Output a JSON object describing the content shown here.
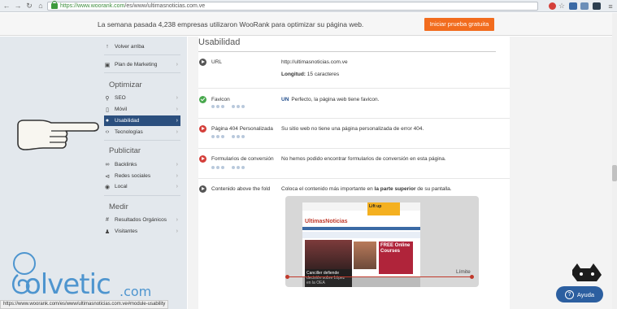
{
  "browser": {
    "back_icon": "back-arrow-icon",
    "forward_icon": "forward-arrow-icon",
    "reload_icon": "reload-icon",
    "home_icon": "home-icon",
    "url_host": "https://www.woorank.com",
    "url_path": "/es/www/ultimasnoticias.com.ve"
  },
  "banner": {
    "text": "La semana pasada 4,238 empresas utilizaron WooRank para optimizar su página web.",
    "cta_label": "Iniciar prueba gratuita",
    "cta_color": "#f26c1e"
  },
  "sidebar": {
    "top_items": [
      {
        "icon": "arrow-up-icon",
        "label": "Volver arriba"
      },
      {
        "icon": "document-icon",
        "label": "Plan de Marketing"
      }
    ],
    "groups": [
      {
        "heading": "Optimizar",
        "items": [
          {
            "icon": "search-icon",
            "label": "SEO"
          },
          {
            "icon": "mobile-icon",
            "label": "Móvil"
          },
          {
            "icon": "user-icon",
            "label": "Usabilidad",
            "active": true
          },
          {
            "icon": "code-icon",
            "label": "Tecnologías"
          }
        ]
      },
      {
        "heading": "Publicitar",
        "items": [
          {
            "icon": "link-icon",
            "label": "Backlinks"
          },
          {
            "icon": "share-icon",
            "label": "Redes sociales"
          },
          {
            "icon": "location-pin-icon",
            "label": "Local"
          }
        ]
      },
      {
        "heading": "Medir",
        "items": [
          {
            "icon": "hashtag-icon",
            "label": "Resultados Orgánicos"
          },
          {
            "icon": "visitors-icon",
            "label": "Visitantes"
          }
        ]
      }
    ],
    "active_color": "#2b4f7e"
  },
  "main": {
    "section_title": "Usabilidad",
    "rows": [
      {
        "label": "URL",
        "status": "neutral",
        "value": "http://ultimasnoticias.com.ve",
        "detail_label": "Longitud:",
        "detail_value": "15 caracteres"
      },
      {
        "label": "Favicon",
        "status": "ok",
        "value_badge": "UN",
        "value": "Perfecto, la página web tiene favicon."
      },
      {
        "label": "Página 404 Personalizada",
        "status": "bad",
        "value": "Su sitio web no tiene una página personalizada de error 404."
      },
      {
        "label": "Formularios de conversión",
        "status": "bad",
        "value": "No hemos podido encontrar formularios de conversión en esta página."
      },
      {
        "label": "Contenido above the fold",
        "status": "neutral",
        "value_pre": "Coloca el contenido más importante en ",
        "value_bold": "la parte superior",
        "value_post": " de su pantalla."
      }
    ],
    "preview": {
      "logo_a": "Ultimas",
      "logo_b": "Noticias",
      "ad_text": "Lift up",
      "caption": "Canciller defiende decisión sobre López en la OEA",
      "promo": "FREE Online Courses",
      "fold_label": "Límite"
    }
  },
  "status_bar": {
    "text": "https://www.woorank.com/es/www/ultimasnoticias.com.ve#module-usability"
  },
  "help": {
    "label": "Ayuda"
  },
  "watermark": {
    "text": "olvetic",
    "suffix": ".com"
  }
}
